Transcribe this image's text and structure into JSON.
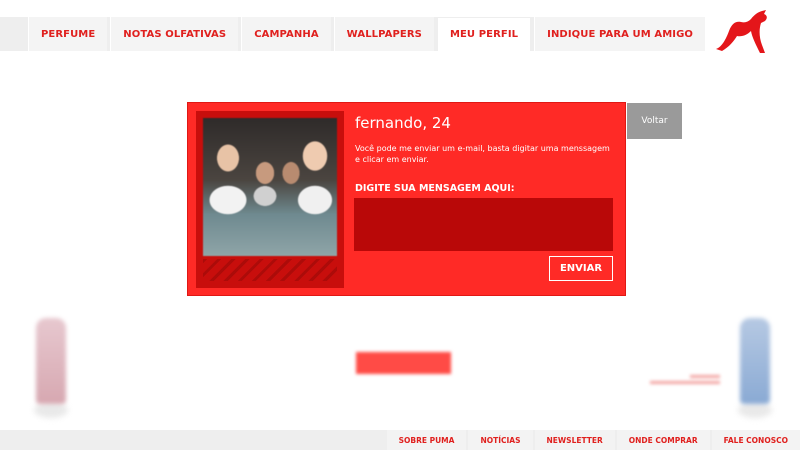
{
  "nav": {
    "tabs": [
      {
        "label": "PERFUME"
      },
      {
        "label": "NOTAS OLFATIVAS"
      },
      {
        "label": "CAMPANHA"
      },
      {
        "label": "WALLPAPERS"
      },
      {
        "label": "MEU PERFIL"
      },
      {
        "label": "INDIQUE PARA UM AMIGO"
      }
    ],
    "active_tab": "MEU PERFIL"
  },
  "logo": {
    "icon": "puma-cat-icon",
    "color": "#e4161a"
  },
  "profile": {
    "name": "fernando, 24",
    "description": "Você pode me enviar um e-mail,  basta digitar uma menssagem e clicar em enviar.",
    "message_label": "DIGITE SUA MENSAGEM AQUI:",
    "message_value": "",
    "send_label": "ENVIAR",
    "back_label": "Voltar"
  },
  "colors": {
    "brand_red": "#ff2a26",
    "input_red": "#b90808",
    "back_gray": "#9a9a9a"
  },
  "footer": {
    "links": [
      {
        "label": "SOBRE PUMA"
      },
      {
        "label": "NOTÍCIAS"
      },
      {
        "label": "NEWSLETTER"
      },
      {
        "label": "ONDE COMPRAR"
      },
      {
        "label": "FALE CONOSCO"
      }
    ]
  }
}
